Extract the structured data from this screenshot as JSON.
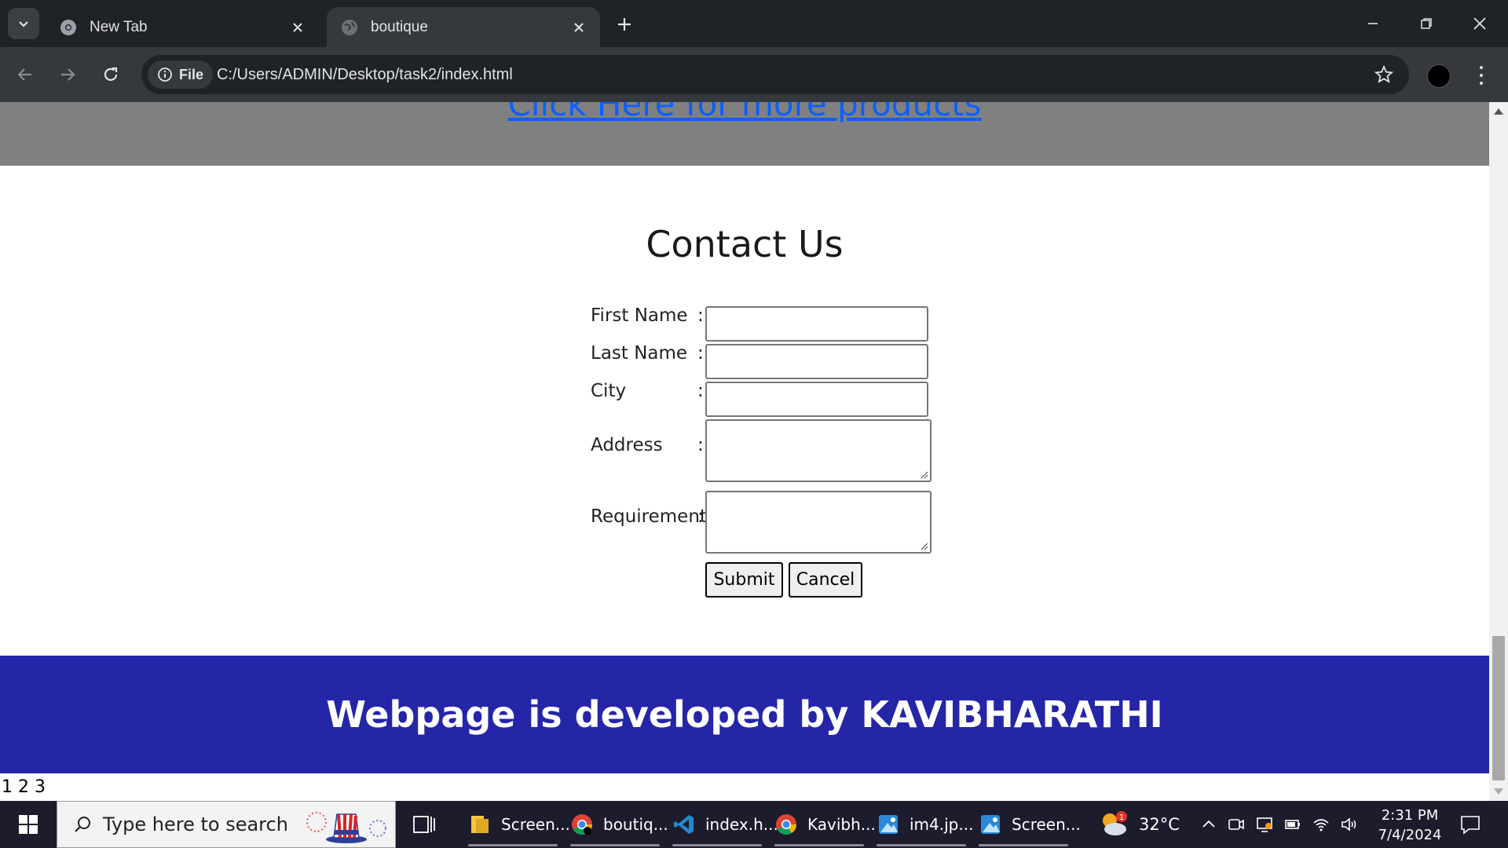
{
  "browser": {
    "tabs": [
      {
        "title": "New Tab",
        "active": false
      },
      {
        "title": "boutique",
        "active": true
      }
    ],
    "site_chip_label": "File",
    "url": "C:/Users/ADMIN/Desktop/task2/index.html"
  },
  "page": {
    "products_link": "Click Here for more products",
    "contact": {
      "title": "Contact Us",
      "fields": [
        {
          "label": "First Name",
          "colon": ":",
          "value": ""
        },
        {
          "label": "Last Name",
          "colon": ":",
          "value": ""
        },
        {
          "label": "City",
          "colon": ":",
          "value": ""
        },
        {
          "label": "Address",
          "colon": ":",
          "value": ""
        },
        {
          "label": "Requirement",
          "colon": ":",
          "value": ""
        }
      ],
      "submit_label": "Submit",
      "cancel_label": "Cancel"
    },
    "footer_text": "Webpage is developed by KAVIBHARATHI",
    "page_numbers": "1 2 3"
  },
  "taskbar": {
    "search_placeholder": "Type here to search",
    "items": [
      {
        "label": "Screen...",
        "icon": "file-explorer-icon"
      },
      {
        "label": "boutiq...",
        "icon": "chrome-icon"
      },
      {
        "label": "index.h...",
        "icon": "vscode-icon"
      },
      {
        "label": "Kavibh...",
        "icon": "chrome-icon"
      },
      {
        "label": "im4.jp...",
        "icon": "photos-icon"
      },
      {
        "label": "Screen...",
        "icon": "photos-icon"
      }
    ],
    "weather_temp": "32°C",
    "weather_badge": "1",
    "time": "2:31 PM",
    "date": "7/4/2024"
  },
  "colors": {
    "footer_bg": "#2525a8",
    "products_band_bg": "#808080",
    "link": "#0b5fff",
    "chrome_dark": "#1f2226",
    "chrome_toolbar": "#35383c",
    "taskbar_bg": "#1c1c2c"
  }
}
